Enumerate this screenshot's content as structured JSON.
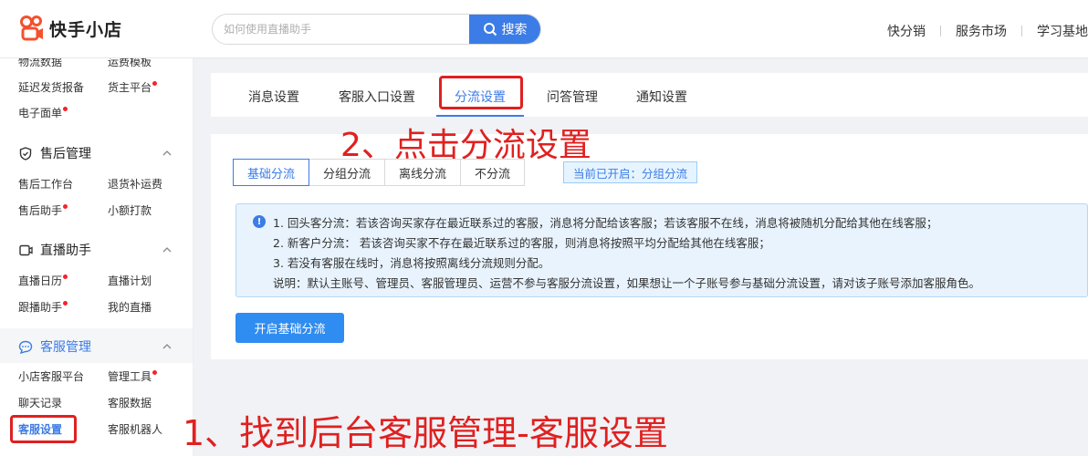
{
  "header": {
    "logo_text": "快手小店",
    "search_placeholder": "如何使用直播助手",
    "search_button": "搜索",
    "links": [
      "快分销",
      "服务市场",
      "学习基地"
    ]
  },
  "sidebar": {
    "top_items": [
      {
        "label": "物流数据",
        "dot": false
      },
      {
        "label": "运费模板",
        "dot": false
      },
      {
        "label": "延迟发货报备",
        "dot": false
      },
      {
        "label": "货主平台",
        "dot": true
      },
      {
        "label": "电子面单",
        "dot": true
      }
    ],
    "sections": [
      {
        "title": "售后管理",
        "icon": "shield-icon",
        "items": [
          {
            "label": "售后工作台",
            "dot": false
          },
          {
            "label": "退货补运费",
            "dot": false
          },
          {
            "label": "售后助手",
            "dot": true
          },
          {
            "label": "小额打款",
            "dot": false
          }
        ]
      },
      {
        "title": "直播助手",
        "icon": "live-icon",
        "items": [
          {
            "label": "直播日历",
            "dot": true
          },
          {
            "label": "直播计划",
            "dot": false
          },
          {
            "label": "跟播助手",
            "dot": true
          },
          {
            "label": "我的直播",
            "dot": false
          }
        ]
      },
      {
        "title": "客服管理",
        "icon": "chat-icon",
        "items": [
          {
            "label": "小店客服平台",
            "dot": false
          },
          {
            "label": "管理工具",
            "dot": true
          },
          {
            "label": "聊天记录",
            "dot": false
          },
          {
            "label": "客服数据",
            "dot": false
          },
          {
            "label": "客服设置",
            "dot": false
          },
          {
            "label": "客服机器人",
            "dot": false
          }
        ]
      }
    ]
  },
  "tabs": [
    "消息设置",
    "客服入口设置",
    "分流设置",
    "问答管理",
    "通知设置"
  ],
  "active_tab": "分流设置",
  "segments": [
    "基础分流",
    "分组分流",
    "离线分流",
    "不分流"
  ],
  "active_segment": "基础分流",
  "current_status": "当前已开启：分组分流",
  "info": {
    "lines": [
      "1. 回头客分流：若该咨询买家存在最近联系过的客服，消息将分配给该客服；若该客服不在线，消息将被随机分配给其他在线客服；",
      "2. 新客户分流：  若该咨询买家不存在最近联系过的客服，则消息将按照平均分配给其他在线客服；",
      "3. 若没有客服在线时，消息将按照离线分流规则分配。",
      "说明：默认主账号、管理员、客服管理员、运营不参与客服分流设置，如果想让一个子账号参与基础分流设置，请对该子账号添加客服角色。"
    ]
  },
  "primary_button": "开启基础分流",
  "annotations": {
    "step1": "1、找到后台客服管理-客服设置",
    "step2": "2、点击分流设置"
  },
  "colors": {
    "accent": "#3c7ce6",
    "annotation": "#e02020",
    "logo": "#f5502d"
  }
}
